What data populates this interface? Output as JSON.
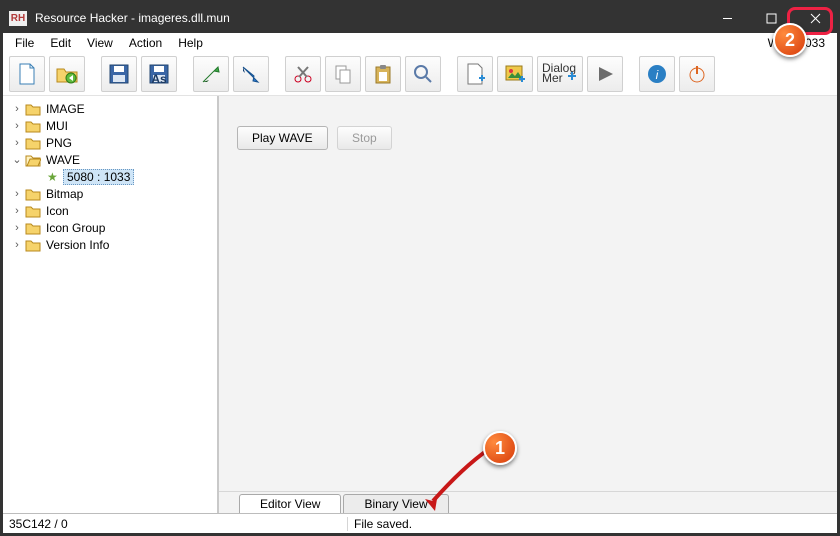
{
  "title": "Resource Hacker - imageres.dll.mun",
  "app_icon_text": "RH",
  "menubar": {
    "file": "File",
    "edit": "Edit",
    "view": "View",
    "action": "Action",
    "help": "Help",
    "right_info": "WAVE          033"
  },
  "tree": {
    "items": [
      {
        "label": "IMAGE",
        "exp": ">"
      },
      {
        "label": "MUI",
        "exp": ">"
      },
      {
        "label": "PNG",
        "exp": ">"
      },
      {
        "label": "WAVE",
        "exp": "v",
        "children": [
          {
            "label": "5080 : 1033"
          }
        ]
      },
      {
        "label": "Bitmap",
        "exp": ">"
      },
      {
        "label": "Icon",
        "exp": ">"
      },
      {
        "label": "Icon Group",
        "exp": ">"
      },
      {
        "label": "Version Info",
        "exp": ">"
      }
    ]
  },
  "content": {
    "play_label": "Play WAVE",
    "stop_label": "Stop"
  },
  "tabs": {
    "editor": "Editor View",
    "binary": "Binary View"
  },
  "status": {
    "left": "35C142 / 0",
    "center": "File saved."
  },
  "annotations": {
    "bubble1": "1",
    "bubble2": "2"
  }
}
